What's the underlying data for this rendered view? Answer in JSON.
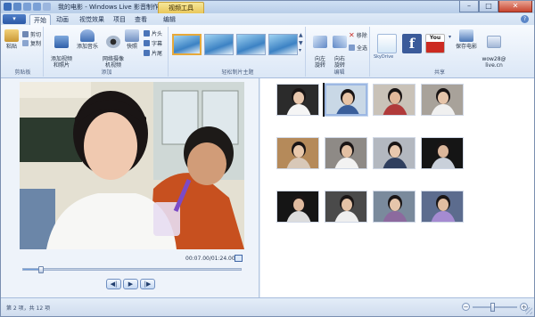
{
  "window": {
    "title": "我的电影 - Windows Live 影音制作",
    "tools_tab": "视频工具",
    "minimize_glyph": "–",
    "maximize_glyph": "□",
    "close_glyph": "✕"
  },
  "tabs": [
    "开始",
    "动画",
    "视觉效果",
    "项目",
    "查看",
    "编辑"
  ],
  "active_tab": "开始",
  "ribbon": {
    "clipboard": {
      "label": "剪贴板",
      "paste": "粘贴",
      "cut": "剪切",
      "copy": "复制"
    },
    "add": {
      "label": "添加",
      "add_video_photos": "添加视频\n和照片",
      "add_music": "添加音乐",
      "webcam_video": "网络摄像\n机视频",
      "snapshot": "快照",
      "title": "片头",
      "caption": "字幕",
      "credits": "片尾"
    },
    "autothemes": {
      "label": "轻松制片主题",
      "theme_count": 4,
      "selected_index": 0
    },
    "editing": {
      "label": "编辑",
      "rotate_left": "向左\n旋转",
      "rotate_right": "向右\n旋转",
      "remove": "移除",
      "select_all": "全选"
    },
    "share": {
      "label": "共享",
      "skydrive": "SkyDrive",
      "save_movie": "保存电影",
      "account": "wow28@\nlive.cn"
    }
  },
  "preview": {
    "time": "00:07.00/01:24.00",
    "progress_fraction": 0.08,
    "controls": [
      "◀|",
      "▶",
      "|▶"
    ]
  },
  "storyboard": {
    "clip_count": 12,
    "selected_index": 1
  },
  "status": {
    "text": "第 2 项，共 12 项",
    "zoom_fraction": 0.45
  },
  "colors": {
    "accent": "#2a58a6",
    "tools_tab": "#e9c75a",
    "close": "#c8452f",
    "selection": "#9db8e3"
  }
}
